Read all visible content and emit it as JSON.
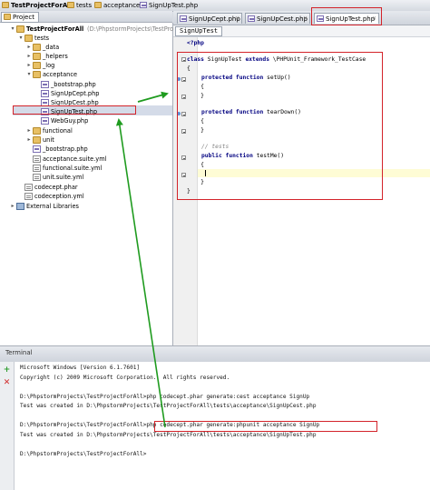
{
  "breadcrumb": {
    "items": [
      "TestProjectForAll",
      "tests",
      "acceptance",
      "SignUpTest.php"
    ]
  },
  "project_panel": {
    "tab_label": "Project",
    "tree": [
      {
        "label": "TestProjectForAll",
        "path": "(D:\\PhpstormProjects\\TestProjectForAll)",
        "type": "folder",
        "depth": 0,
        "expanded": true
      },
      {
        "label": "tests",
        "type": "folder",
        "depth": 1,
        "expanded": true
      },
      {
        "label": "_data",
        "type": "folder",
        "depth": 2,
        "expanded": false
      },
      {
        "label": "_helpers",
        "type": "folder",
        "depth": 2,
        "expanded": false
      },
      {
        "label": "_log",
        "type": "folder",
        "depth": 2,
        "expanded": false
      },
      {
        "label": "acceptance",
        "type": "folder",
        "depth": 2,
        "expanded": true
      },
      {
        "label": "_bootstrap.php",
        "type": "php",
        "depth": 3
      },
      {
        "label": "SignUpCept.php",
        "type": "php",
        "depth": 3
      },
      {
        "label": "SignUpCest.php",
        "type": "php",
        "depth": 3
      },
      {
        "label": "SignUpTest.php",
        "type": "php",
        "depth": 3,
        "selected": true
      },
      {
        "label": "WebGuy.php",
        "type": "php",
        "depth": 3
      },
      {
        "label": "functional",
        "type": "folder",
        "depth": 2,
        "expanded": false
      },
      {
        "label": "unit",
        "type": "folder",
        "depth": 2,
        "expanded": false
      },
      {
        "label": "_bootstrap.php",
        "type": "php",
        "depth": 2
      },
      {
        "label": "acceptance.suite.yml",
        "type": "yml",
        "depth": 2
      },
      {
        "label": "functional.suite.yml",
        "type": "yml",
        "depth": 2
      },
      {
        "label": "unit.suite.yml",
        "type": "yml",
        "depth": 2
      },
      {
        "label": "codecept.phar",
        "type": "yml",
        "depth": 1
      },
      {
        "label": "codeception.yml",
        "type": "yml",
        "depth": 1
      },
      {
        "label": "External Libraries",
        "type": "lib",
        "depth": 0,
        "expanded": false
      }
    ]
  },
  "editor": {
    "tabs": [
      {
        "label": "SignUpCept.php",
        "active": false
      },
      {
        "label": "SignUpCest.php",
        "active": false
      },
      {
        "label": "SignUpTest.php",
        "active": true
      }
    ],
    "crumb": "SignUpTest",
    "code": {
      "php_open": "<?php",
      "class_kw": "class",
      "class_name": " SignUpTest ",
      "extends_kw": "extends",
      "parent": " \\PHPUnit_Framework_TestCase",
      "brace_open": "{",
      "brace_close": "}",
      "protected_kw": "protected function",
      "public_kw": "public function",
      "setup_fn": " setUp()",
      "teardown_fn": " tearDown()",
      "testme_fn": " testMe()",
      "comment": "// tests",
      "inner_open": "    {",
      "inner_close": "    }"
    }
  },
  "terminal": {
    "title": "Terminal",
    "lines": [
      "Microsoft Windows [Version 6.1.7601]",
      "Copyright (c) 2009 Microsoft Corporation.  All rights reserved.",
      "",
      "D:\\PhpstormProjects\\TestProjectForAll>php codecept.phar generate:cest acceptance SignUp",
      "Test was created in D:\\PhpstormProjects\\TestProjectForAll\\tests\\acceptance\\SignUpCest.php",
      "",
      "D:\\PhpstormProjects\\TestProjectForAll>php codecept.phar generate:phpunit acceptance SignUp",
      "Test was created in D:\\PhpstormProjects\\TestProjectForAll\\tests\\acceptance\\SignUpTest.php",
      "",
      "D:\\PhpstormProjects\\TestProjectForAll>"
    ]
  },
  "colors": {
    "annotation_red": "#d3232a",
    "annotation_green": "#1f9b1f",
    "keyword_blue": "#000080"
  }
}
